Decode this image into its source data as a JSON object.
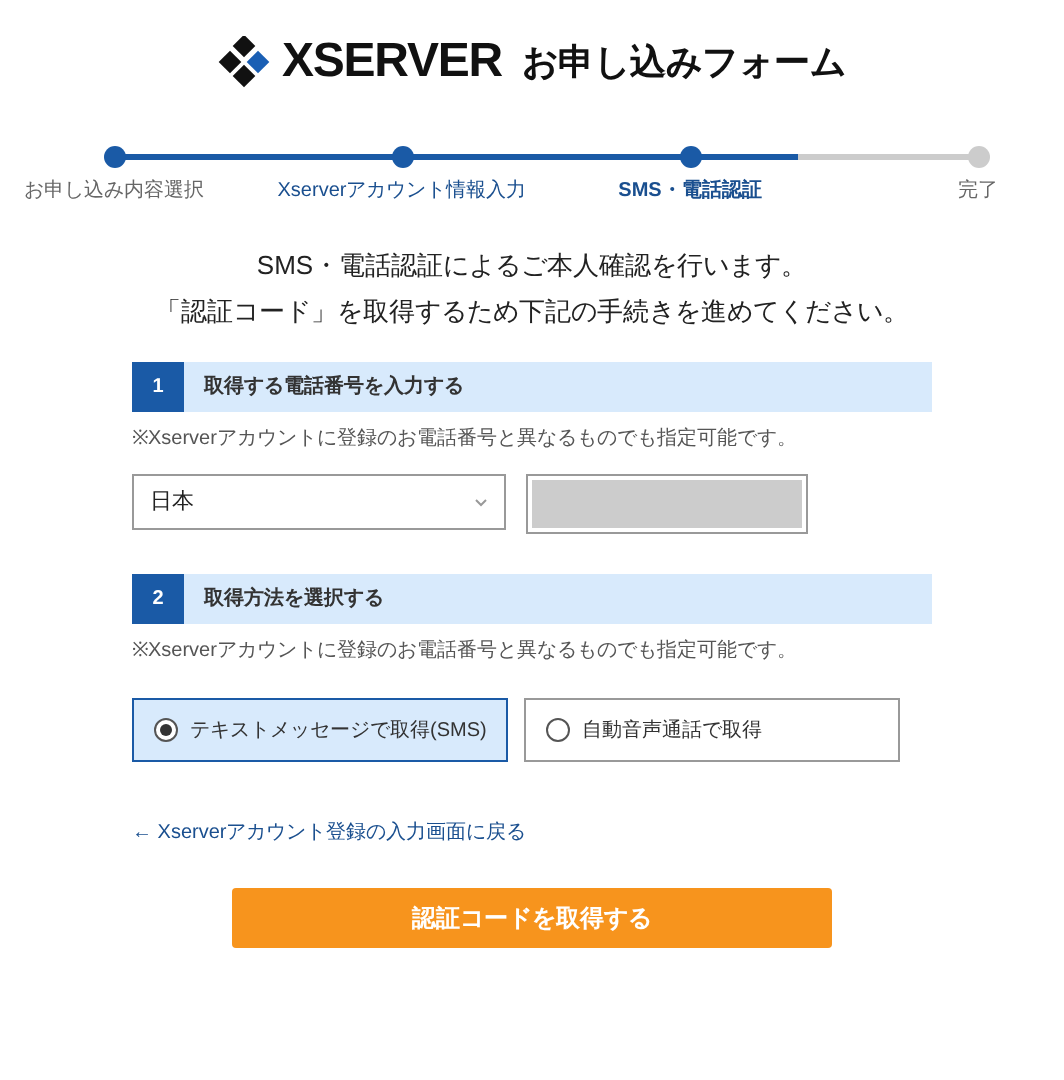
{
  "header": {
    "logo": "XSERVER",
    "title": "お申し込みフォーム"
  },
  "steps": [
    {
      "label": "お申し込み内容選択",
      "reached": true,
      "selected": false
    },
    {
      "label": "Xserverアカウント情報入力",
      "reached": true,
      "selected": false
    },
    {
      "label": "SMS・電話認証",
      "reached": true,
      "selected": true
    },
    {
      "label": "完了",
      "reached": false,
      "selected": false
    }
  ],
  "intro": [
    "SMS・電話認証によるご本人確認を行います。",
    "「認証コード」を取得するため下記の手続きを進めてください。"
  ],
  "section1": {
    "number": "1",
    "title": "取得する電話番号を入力する",
    "note": "※Xserverアカウントに登録のお電話番号と異なるものでも指定可能です。",
    "country": "日本"
  },
  "section2": {
    "number": "2",
    "title": "取得方法を選択する",
    "note": "※Xserverアカウントに登録のお電話番号と異なるものでも指定可能です。",
    "options": [
      {
        "label": "テキストメッセージで取得(SMS)",
        "selected": true
      },
      {
        "label": "自動音声通話で取得",
        "selected": false
      }
    ]
  },
  "back_link": "← Xserverアカウント登録の入力画面に戻る",
  "submit": "認証コードを取得する"
}
